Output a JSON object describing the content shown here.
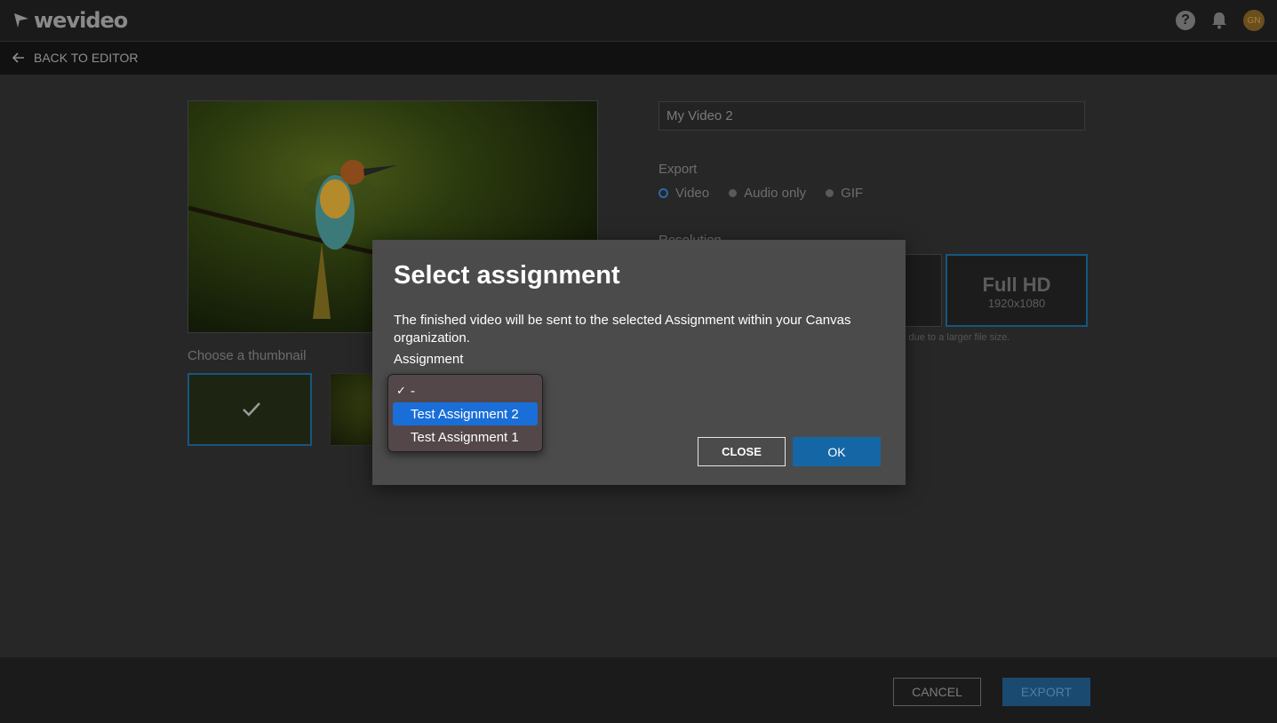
{
  "app": {
    "name": "wevideo"
  },
  "header": {
    "back_label": "BACK TO EDITOR",
    "avatar_initials": "GN"
  },
  "editor": {
    "thumbnail_label": "Choose a thumbnail",
    "title_value": "My Video 2",
    "export_label": "Export",
    "export_options": [
      "Video",
      "Audio only",
      "GIF"
    ],
    "export_selected": "Video",
    "resolution_label": "Resolution",
    "resolution_card": {
      "name": "Full HD",
      "size": "1920x1080",
      "selected": true
    },
    "resolution_note": "s due to a larger file size."
  },
  "footer": {
    "cancel_label": "CANCEL",
    "export_label": "EXPORT"
  },
  "modal": {
    "title": "Select assignment",
    "description": "The finished video will be sent to the selected Assignment within your Canvas organization.",
    "field_label": "Assignment",
    "close_label": "CLOSE",
    "ok_label": "OK",
    "options": [
      "-",
      "Test Assignment 2",
      "Test Assignment 1"
    ],
    "selected_option": "-",
    "highlighted_option": "Test Assignment 2"
  },
  "colors": {
    "accent": "#1566a5",
    "highlight": "#1a6ed8",
    "selection_border": "#17567f"
  }
}
